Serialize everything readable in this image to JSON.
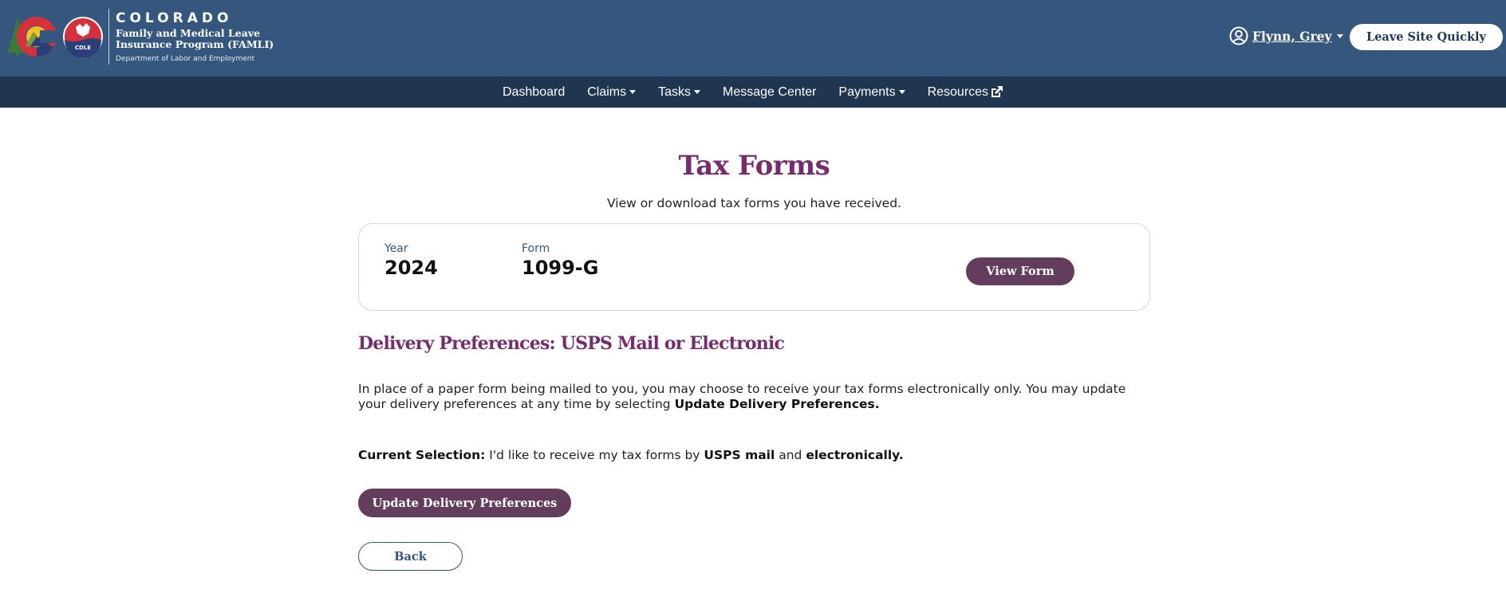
{
  "header": {
    "brand": {
      "state": "COLORADO",
      "program_line1": "Family and Medical Leave",
      "program_line2": "Insurance Program (FAMLI)",
      "department": "Department of Labor and Employment",
      "cdle_badge": "CDLE"
    },
    "user": {
      "name": "Flynn, Grey",
      "icon": "user-circle-icon"
    },
    "leave_button": "Leave Site Quickly"
  },
  "nav": {
    "items": [
      {
        "label": "Dashboard",
        "dropdown": false
      },
      {
        "label": "Claims",
        "dropdown": true
      },
      {
        "label": "Tasks",
        "dropdown": true
      },
      {
        "label": "Message Center",
        "dropdown": false
      },
      {
        "label": "Payments",
        "dropdown": true
      },
      {
        "label": "Resources",
        "dropdown": false,
        "icon": "external-link-icon"
      }
    ]
  },
  "page": {
    "title": "Tax Forms",
    "subtitle": "View or download tax forms you have received.",
    "form_card": {
      "year_label": "Year",
      "year_value": "2024",
      "form_label": "Form",
      "form_value": "1099-G",
      "view_button": "View Form"
    },
    "delivery": {
      "title": "Delivery Preferences: USPS Mail or Electronic",
      "para_text": "In place of a paper form being mailed to you, you may choose to receive your tax forms electronically only. You may update your delivery preferences at any time by selecting ",
      "para_bold": "Update Delivery Preferences.",
      "current_label": "Current Selection:",
      "current_text_1": " I'd like to receive my tax forms by ",
      "current_bold_1": "USPS mail",
      "current_text_2": " and ",
      "current_bold_2": "electronically."
    },
    "update_button": "Update Delivery Preferences",
    "back_button": "Back"
  },
  "colors": {
    "header_bg": "#35577d",
    "nav_bg": "#1f3550",
    "accent_purple": "#772d6b",
    "button_purple": "#643d5c"
  }
}
